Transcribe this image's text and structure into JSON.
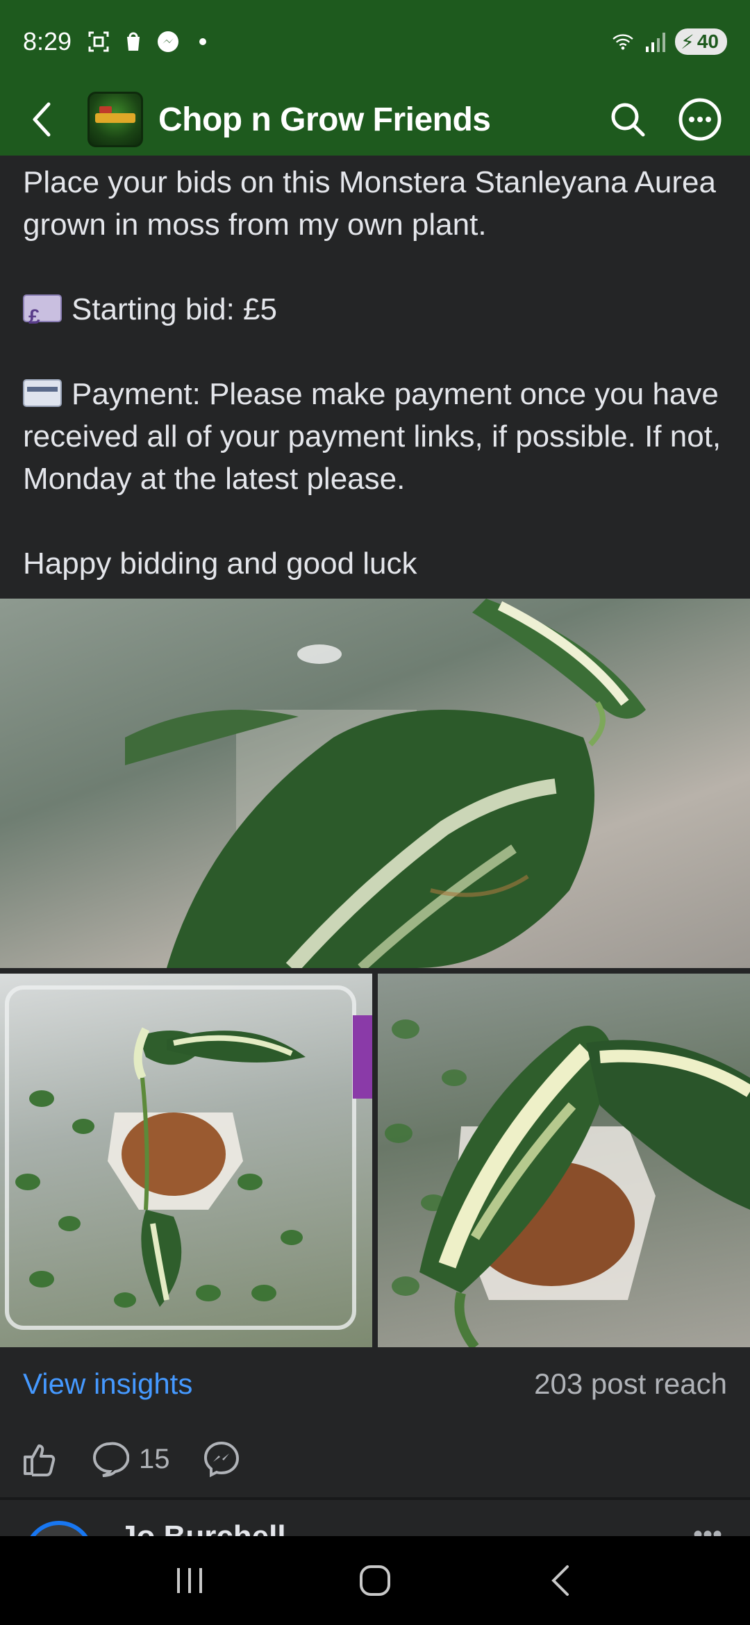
{
  "status_bar": {
    "time": "8:29",
    "battery": "40"
  },
  "app_bar": {
    "title": "Chop n Grow Friends"
  },
  "post": {
    "paragraphs": [
      "Place your bids on this Monstera Stanleyana Aurea grown in moss from my own plant.",
      "Starting bid: £5",
      "Payment: Please make payment once you have received all of your payment links, if possible. If not, Monday at the latest please.",
      "Happy bidding and good luck"
    ],
    "insights_label": "View insights",
    "reach": "203 post reach",
    "comment_count": "15"
  },
  "next_post": {
    "author": "Jo Burchell"
  },
  "colors": {
    "header_green": "#1e5a1e",
    "background": "#242526",
    "link_blue": "#4599ff"
  }
}
